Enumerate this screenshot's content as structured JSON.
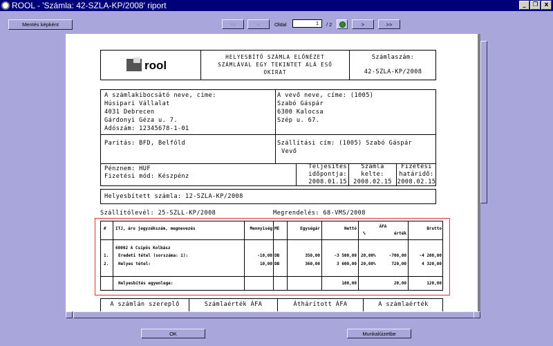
{
  "window": {
    "title": "ROOL  - 'Számla: 42-SZLA-KP/2008' riport",
    "buttons": [
      "_",
      "❐",
      "x"
    ]
  },
  "toolbar": {
    "save_image": "Mentés képként",
    "first": "<<",
    "prev": "<",
    "page_label": "Oldal",
    "page_value": "1",
    "page_total": "/ 2",
    "next": ">",
    "last": ">>"
  },
  "report": {
    "header": {
      "logo_text": "rool",
      "title_line1": "HELYESBÍTŐ SZÁMLA ELŐNÉZET",
      "title_line2": "SZÁMLÁVAL EGY TEKINTET ALÁ ESŐ",
      "title_line3": "OKIRAT",
      "invoice_no_label": "Számlaszám:",
      "invoice_no": "42-SZLA-KP/2008"
    },
    "seller": {
      "label": "A számlakibocsátó neve, címe:",
      "name": "Húsipari Vállalat",
      "city": "4031 Debrecen",
      "street": "Gárdonyi Géza u. 7.",
      "tax": "Adószám: 12345678-1-01"
    },
    "buyer": {
      "label": "A vevő neve, címe: (1005)",
      "name": "Szabó Gáspár",
      "city": "6300 Kalocsa",
      "street": "Szép u. 67."
    },
    "parity": "Paritás: BFD, Belföld",
    "shipping": {
      "line1": "Szállítási cím: (1005) Szabó Gáspár",
      "line2": "Vevő"
    },
    "currency": "Pénznem: HUF",
    "payment": "Fizetési mód: Készpénz",
    "fulfillment": {
      "label1": "Teljesítés",
      "label2": "időpontja:",
      "value": "2008.01.15"
    },
    "invoice_date": {
      "label1": "Számla",
      "label2": "kelte:",
      "value": "2008.02.15"
    },
    "due_date": {
      "label1": "Fizetési",
      "label2": "határidő:",
      "value": "2008.02.15"
    },
    "corrected": "Helyesbített számla: 12-SZLA-KP/2008",
    "delivery": "Szállítólevél: 25-SZLL-KP/2008",
    "order": "Megrendelés: 68-VMS/2008",
    "items": {
      "headers": {
        "num": "#",
        "desc": "ITJ, áru jegyzékszám, megnevezés",
        "qty": "Mennyiség",
        "unit": "ME",
        "unit_price": "Egységár",
        "net": "Nettó",
        "vat": "ÁFA",
        "vat_pct": "%",
        "vat_amount": "érték",
        "gross": "Brutto"
      },
      "group": "60002 A Csípős Kolbász",
      "rows": [
        {
          "num": "1.",
          "desc": "Eredeti tétel (sorszáma: 1):",
          "qty": "-10,00",
          "unit": "DB",
          "price": "350,00",
          "net": "-3 500,00",
          "vat_pct": "20,00%",
          "vat_amount": "-700,00",
          "gross": "-4 200,00"
        },
        {
          "num": "2.",
          "desc": "Helyes tétel:",
          "qty": "10,00",
          "unit": "DB",
          "price": "360,00",
          "net": "3 600,00",
          "vat_pct": "20,00%",
          "vat_amount": "720,00",
          "gross": "4 320,00"
        }
      ],
      "balance_label": "Helyesbítés egyenlege:",
      "balance_net": "100,00",
      "balance_vat": "20,00",
      "balance_gross": "120,00"
    },
    "summary_headers": [
      "A számlán szereplő",
      "Számlaérték ÁFA",
      "Áthárított ÁFA",
      "A számlaérték"
    ]
  },
  "bottom": {
    "ok": "OK",
    "worksheet": "Munkalúizetbe"
  },
  "colors": {
    "background": "#a8a6da",
    "titlebar": "#000078",
    "highlight": "#e0312f"
  }
}
